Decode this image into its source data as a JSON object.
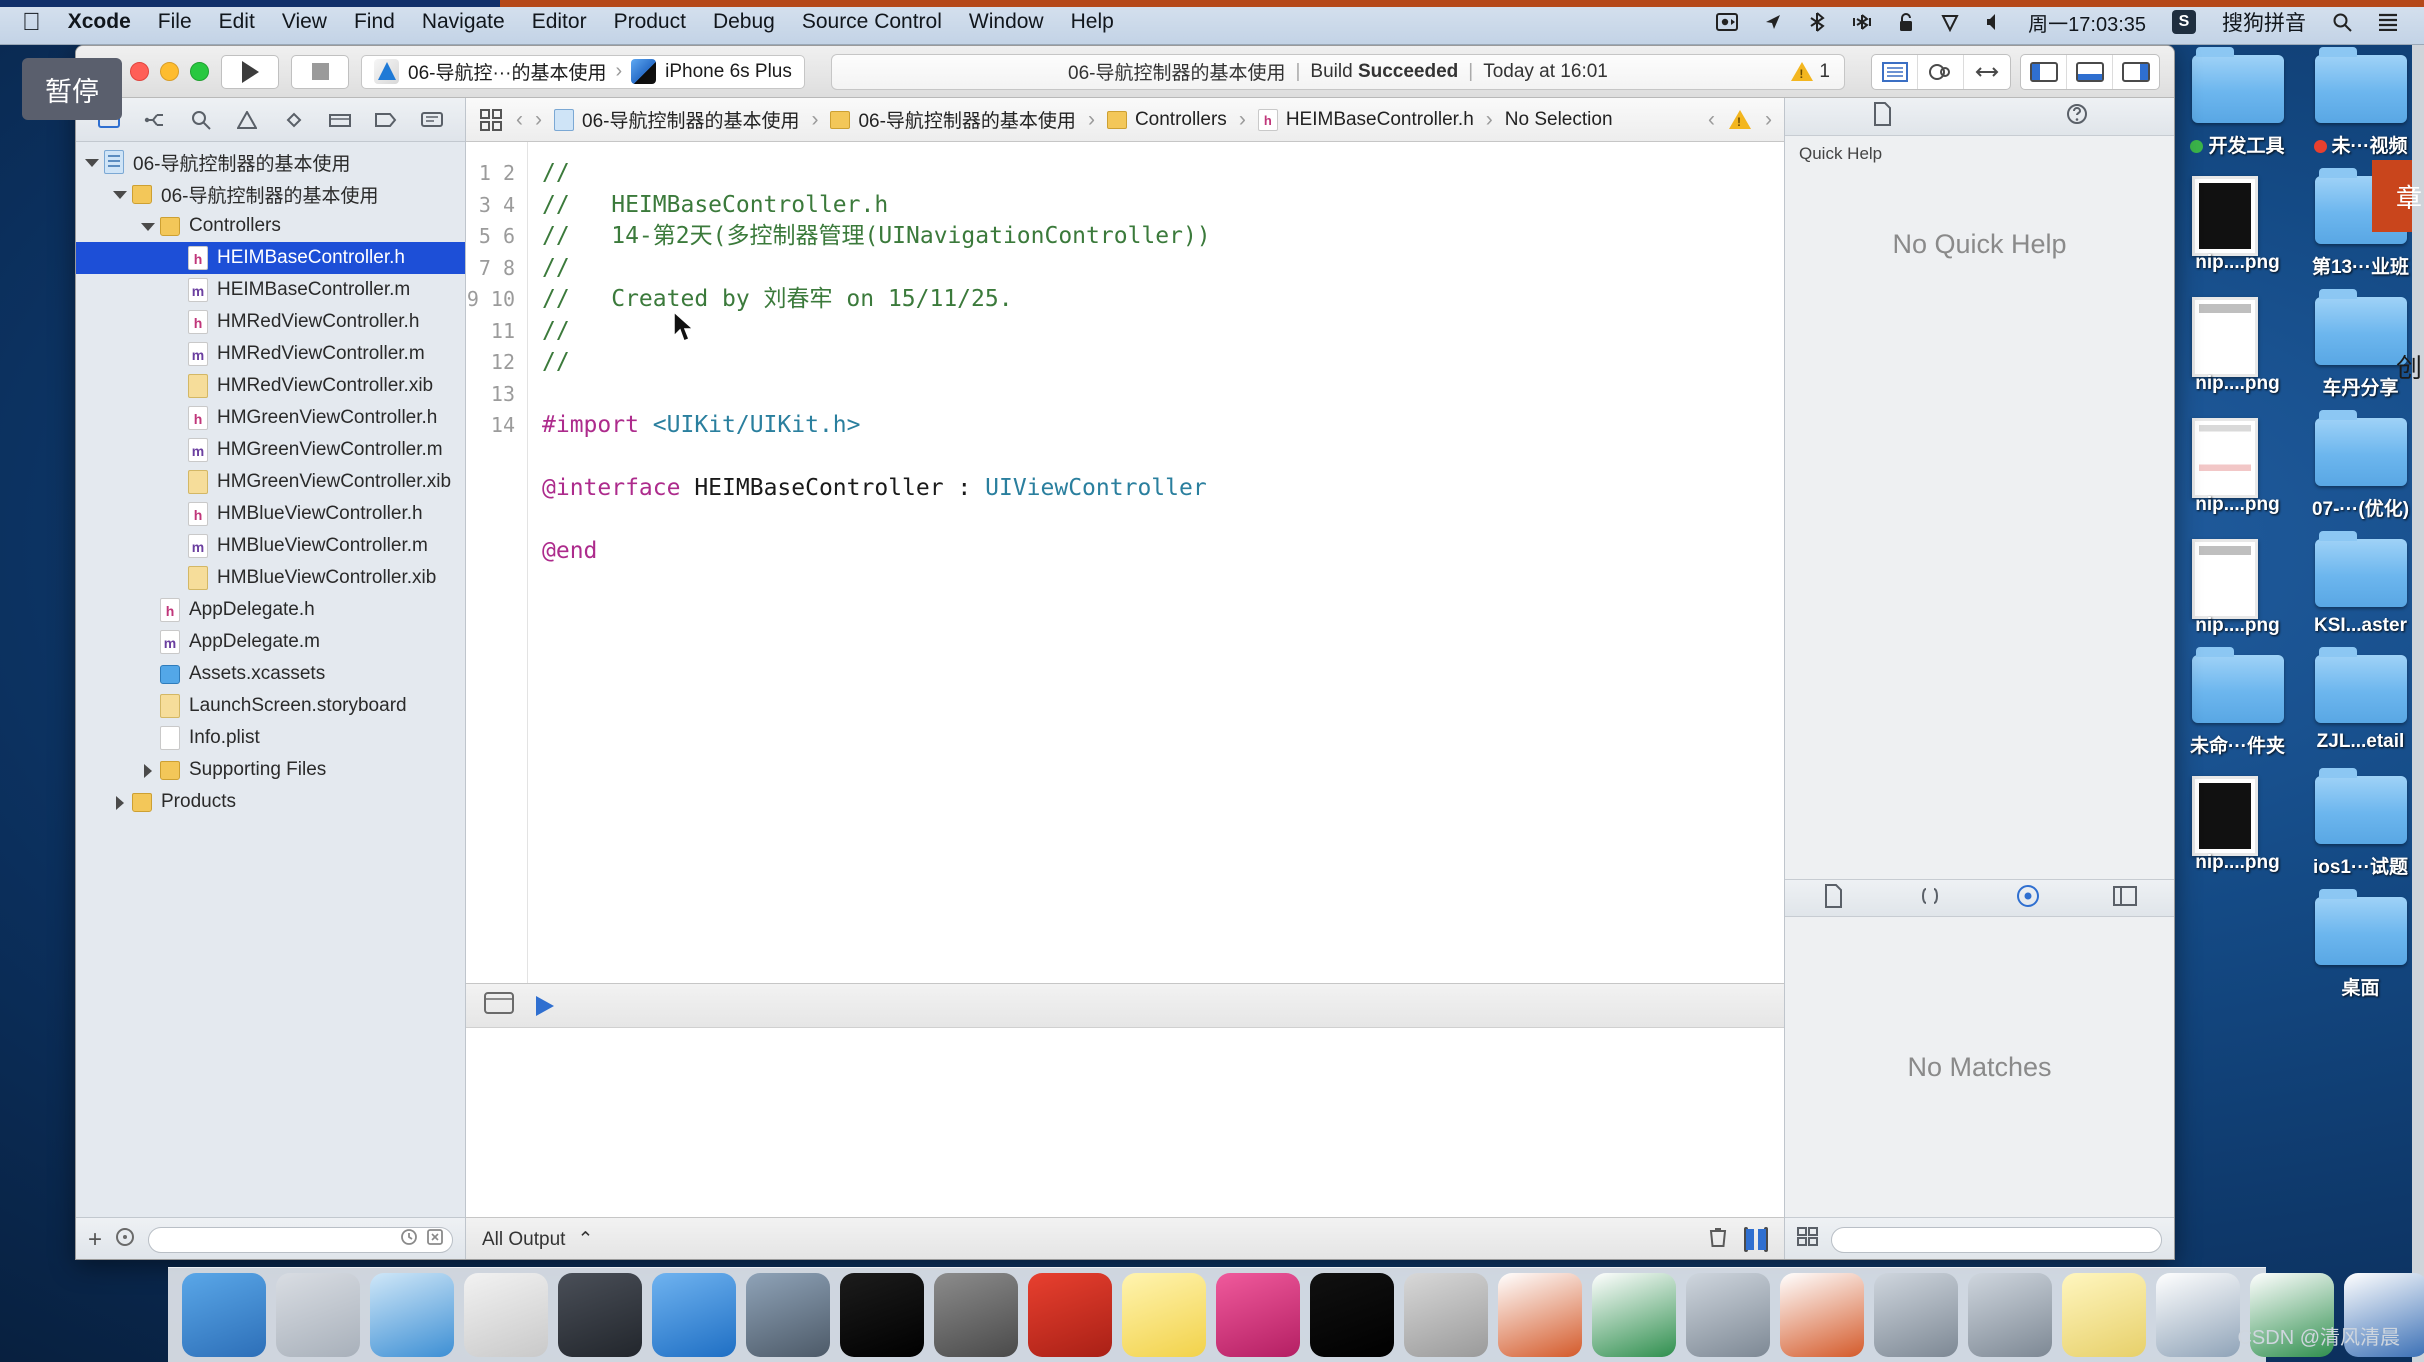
{
  "menubar": {
    "apple": "",
    "items": [
      {
        "label": "Xcode",
        "bold": true
      },
      {
        "label": "File"
      },
      {
        "label": "Edit"
      },
      {
        "label": "View"
      },
      {
        "label": "Find"
      },
      {
        "label": "Navigate"
      },
      {
        "label": "Editor"
      },
      {
        "label": "Product"
      },
      {
        "label": "Debug"
      },
      {
        "label": "Source Control"
      },
      {
        "label": "Window"
      },
      {
        "label": "Help"
      }
    ],
    "status_icons": [
      "screen-record-icon",
      "location-arrow-icon",
      "bluetooth-icon",
      "airdrop-icon",
      "lock-icon",
      "shield-icon",
      "volume-icon"
    ],
    "clock": "周一17:03:35",
    "input_method_badge": "S",
    "input_method_label": "搜狗拼音",
    "search_icon": "search-icon",
    "list_icon": "notification-center-icon"
  },
  "tooltip": {
    "pause_label": "暂停"
  },
  "toolbar": {
    "run_tooltip": "Run",
    "stop_tooltip": "Stop",
    "scheme_name": "06-导航控···的基本使用",
    "scheme_separator": "›",
    "destination": "iPhone 6s Plus",
    "status_project": "06-导航控制器的基本使用",
    "status_sep": "|",
    "status_build_prefix": "Build ",
    "status_build_result": "Succeeded",
    "status_time": "Today at 16:01",
    "warning_count": "1",
    "editor_modes": [
      "standard-editor-icon",
      "assistant-editor-icon",
      "version-editor-icon"
    ],
    "view_toggles": [
      "navigator-toggle-icon",
      "debug-area-toggle-icon",
      "utilities-toggle-icon"
    ]
  },
  "navigator": {
    "tabs": [
      "project-navigator-icon",
      "symbol-navigator-icon",
      "find-navigator-icon",
      "issue-navigator-icon",
      "test-navigator-icon",
      "debug-navigator-icon",
      "breakpoint-navigator-icon",
      "report-navigator-icon"
    ],
    "tree": [
      {
        "label": "06-导航控制器的基本使用",
        "icon": "proj",
        "indent": 0,
        "disc": "open",
        "selected": false
      },
      {
        "label": "06-导航控制器的基本使用",
        "icon": "folder",
        "indent": 1,
        "disc": "open",
        "selected": false
      },
      {
        "label": "Controllers",
        "icon": "folder",
        "indent": 2,
        "disc": "open",
        "selected": false
      },
      {
        "label": "HEIMBaseController.h",
        "icon": "h",
        "indent": 3,
        "disc": "",
        "selected": true
      },
      {
        "label": "HEIMBaseController.m",
        "icon": "m",
        "indent": 3,
        "disc": "",
        "selected": false
      },
      {
        "label": "HMRedViewController.h",
        "icon": "h",
        "indent": 3,
        "disc": "",
        "selected": false
      },
      {
        "label": "HMRedViewController.m",
        "icon": "m",
        "indent": 3,
        "disc": "",
        "selected": false
      },
      {
        "label": "HMRedViewController.xib",
        "icon": "xib",
        "indent": 3,
        "disc": "",
        "selected": false
      },
      {
        "label": "HMGreenViewController.h",
        "icon": "h",
        "indent": 3,
        "disc": "",
        "selected": false
      },
      {
        "label": "HMGreenViewController.m",
        "icon": "m",
        "indent": 3,
        "disc": "",
        "selected": false
      },
      {
        "label": "HMGreenViewController.xib",
        "icon": "xib",
        "indent": 3,
        "disc": "",
        "selected": false
      },
      {
        "label": "HMBlueViewController.h",
        "icon": "h",
        "indent": 3,
        "disc": "",
        "selected": false
      },
      {
        "label": "HMBlueViewController.m",
        "icon": "m",
        "indent": 3,
        "disc": "",
        "selected": false
      },
      {
        "label": "HMBlueViewController.xib",
        "icon": "xib",
        "indent": 3,
        "disc": "",
        "selected": false
      },
      {
        "label": "AppDelegate.h",
        "icon": "h",
        "indent": 2,
        "disc": "",
        "selected": false
      },
      {
        "label": "AppDelegate.m",
        "icon": "m",
        "indent": 2,
        "disc": "",
        "selected": false
      },
      {
        "label": "Assets.xcassets",
        "icon": "xcassets",
        "indent": 2,
        "disc": "",
        "selected": false
      },
      {
        "label": "LaunchScreen.storyboard",
        "icon": "sb",
        "indent": 2,
        "disc": "",
        "selected": false
      },
      {
        "label": "Info.plist",
        "icon": "plist",
        "indent": 2,
        "disc": "",
        "selected": false
      },
      {
        "label": "Supporting Files",
        "icon": "folder",
        "indent": 2,
        "disc": "closed",
        "selected": false
      },
      {
        "label": "Products",
        "icon": "folder",
        "indent": 1,
        "disc": "closed",
        "selected": false
      }
    ],
    "footer": {
      "add_label": "+",
      "filter_placeholder": ""
    }
  },
  "jumpbar": {
    "related_icon": "related-files-icon",
    "back": "‹",
    "forward": "›",
    "crumbs": [
      {
        "label": "06-导航控制器的基本使用",
        "icon": "proj"
      },
      {
        "label": "06-导航控制器的基本使用",
        "icon": "folder"
      },
      {
        "label": "Controllers",
        "icon": "folder"
      },
      {
        "label": "HEIMBaseController.h",
        "icon": "h"
      },
      {
        "label": "No Selection",
        "icon": ""
      }
    ],
    "sep": "›",
    "nav_prev": "‹",
    "nav_next": "›",
    "warning_icon": "warning-triangle-icon"
  },
  "code": {
    "line_numbers": [
      "1",
      "2",
      "3",
      "4",
      "5",
      "6",
      "7",
      "8",
      "9",
      "10",
      "11",
      "12",
      "13",
      "14"
    ],
    "lines": [
      {
        "n": 1,
        "text": "//",
        "kind": "comment"
      },
      {
        "n": 2,
        "text": "//   HEIMBaseController.h",
        "kind": "comment"
      },
      {
        "n": 3,
        "text": "//   14-第2天(多控制器管理(UINavigationController))",
        "kind": "comment"
      },
      {
        "n": 4,
        "text": "//",
        "kind": "comment"
      },
      {
        "n": 5,
        "text": "//   Created by 刘春牢 on 15/11/25.",
        "kind": "comment"
      },
      {
        "n": 6,
        "text": "//",
        "kind": "comment"
      },
      {
        "n": 7,
        "text": "//",
        "kind": "comment"
      },
      {
        "n": 8,
        "text": "",
        "kind": "plain"
      },
      {
        "n": 9,
        "text": "#import <UIKit/UIKit.h>",
        "kind": "import"
      },
      {
        "n": 10,
        "text": "",
        "kind": "plain"
      },
      {
        "n": 11,
        "text": "@interface HEIMBaseController : UIViewController",
        "kind": "interface"
      },
      {
        "n": 12,
        "text": "",
        "kind": "plain"
      },
      {
        "n": 13,
        "text": "@end",
        "kind": "keyword"
      },
      {
        "n": 14,
        "text": "",
        "kind": "plain"
      }
    ],
    "tokens": {
      "import_kw": "#import",
      "import_path": "<UIKit/UIKit.h>",
      "interface_kw": "@interface",
      "interface_name": "HEIMBaseController",
      "interface_colon": ":",
      "interface_super": "UIViewController",
      "end_kw": "@end"
    }
  },
  "console": {
    "filter_label": "All Output",
    "filter_chevron": "⌃",
    "trash_icon": "trash-icon",
    "split_icons": [
      "console-split-icon",
      "console-full-icon"
    ],
    "grid_icon": "grid-icon",
    "search_placeholder": ""
  },
  "utilities": {
    "tabs": [
      "file-inspector-icon",
      "quick-help-icon"
    ],
    "quick_help_title": "Quick Help",
    "quick_help_body": "No Quick Help",
    "library_tabs": [
      "file-template-library-icon",
      "code-snippet-library-icon",
      "object-library-icon",
      "media-library-icon"
    ],
    "library_empty": "No Matches"
  },
  "dock": {
    "items": [
      {
        "name": "finder",
        "color1": "#5aa7e8",
        "color2": "#2d6fb8"
      },
      {
        "name": "launchpad",
        "color1": "#d9dde3",
        "color2": "#a8b0ba"
      },
      {
        "name": "safari",
        "color1": "#cfe7f8",
        "color2": "#3d8fd4"
      },
      {
        "name": "mouse-app",
        "color1": "#f2f2f2",
        "color2": "#c9c9c9"
      },
      {
        "name": "screenflow",
        "color1": "#4a4f58",
        "color2": "#22262c"
      },
      {
        "name": "xcode",
        "color1": "#6fb3f0",
        "color2": "#1f6fc4"
      },
      {
        "name": "simulator",
        "color1": "#8fa3b8",
        "color2": "#4d5a68"
      },
      {
        "name": "terminal",
        "color1": "#1c1c1c",
        "color2": "#000000"
      },
      {
        "name": "system-preferences",
        "color1": "#8c8c8c",
        "color2": "#4a4a4a"
      },
      {
        "name": "xmind",
        "color1": "#e8402f",
        "color2": "#a92016"
      },
      {
        "name": "notes",
        "color1": "#fff4b0",
        "color2": "#f2d24a"
      },
      {
        "name": "keynote-p",
        "color1": "#f05a9c",
        "color2": "#b41f63"
      },
      {
        "name": "executable",
        "color1": "#111111",
        "color2": "#000000"
      },
      {
        "name": "folder-docs",
        "color1": "#d8d8d8",
        "color2": "#9a9a9a"
      },
      {
        "name": "powerpoint",
        "color1": "#ffffff",
        "color2": "#d45a2a"
      },
      {
        "name": "excel",
        "color1": "#ffffff",
        "color2": "#2f8f4e"
      },
      {
        "name": "display-1",
        "color1": "#cfd6de",
        "color2": "#7d8894"
      },
      {
        "name": "powerpoint-2",
        "color1": "#ffffff",
        "color2": "#d45a2a"
      },
      {
        "name": "display-2",
        "color1": "#cfd6de",
        "color2": "#7d8894"
      },
      {
        "name": "display-3",
        "color1": "#cfd6de",
        "color2": "#7d8894"
      },
      {
        "name": "sticky-note",
        "color1": "#fff6bf",
        "color2": "#e7d06a"
      },
      {
        "name": "chart-doc",
        "color1": "#ffffff",
        "color2": "#8fa3b8"
      },
      {
        "name": "excel-2",
        "color1": "#ffffff",
        "color2": "#2f8f4e"
      },
      {
        "name": "word-doc",
        "color1": "#ffffff",
        "color2": "#3a6fb5"
      }
    ],
    "trash": {
      "name": "trash",
      "color1": "#d9dde3",
      "color2": "#9aa3ad"
    }
  },
  "desktop_icons": [
    {
      "label": "开发工具",
      "type": "folder",
      "dot": "#3bb54a"
    },
    {
      "label": "未···视频",
      "type": "folder",
      "dot": "#e8402f"
    },
    {
      "label": "nip....png",
      "type": "png-black",
      "dot": ""
    },
    {
      "label": "第13···业班",
      "type": "folder",
      "dot": ""
    },
    {
      "label": "nip....png",
      "type": "png-doc",
      "dot": ""
    },
    {
      "label": "车丹分享",
      "type": "folder",
      "dot": ""
    },
    {
      "label": "nip....png",
      "type": "png-doc2",
      "dot": ""
    },
    {
      "label": "07-···(优化)",
      "type": "folder",
      "dot": ""
    },
    {
      "label": "nip....png",
      "type": "png-doc",
      "dot": ""
    },
    {
      "label": "KSI...aster",
      "type": "folder",
      "dot": ""
    },
    {
      "label": "未命···件夹",
      "type": "folder",
      "dot": ""
    },
    {
      "label": "ZJL...etail",
      "type": "folder",
      "dot": ""
    },
    {
      "label": "nip....png",
      "type": "png-black",
      "dot": ""
    },
    {
      "label": "ios1···试题",
      "type": "folder",
      "dot": ""
    },
    {
      "label": "",
      "type": "none",
      "dot": ""
    },
    {
      "label": "桌面",
      "type": "folder",
      "dot": ""
    }
  ],
  "side_chars": [
    "章",
    "创"
  ],
  "watermark": "CSDN @清风清晨"
}
